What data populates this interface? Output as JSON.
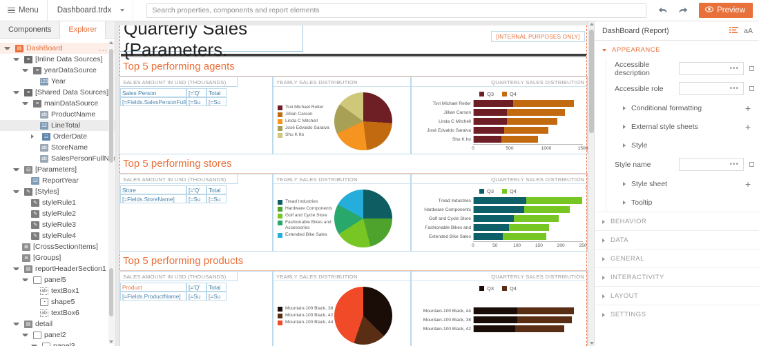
{
  "topbar": {
    "menu_label": "Menu",
    "file_name": "Dashboard.trdx",
    "search_placeholder": "Search properties, components and report elements",
    "search_value": "",
    "undo_icon": "undo-arrow-icon",
    "redo_icon": "redo-arrow-icon",
    "preview_label": "Preview",
    "preview_icon": "eye-icon",
    "accent_color": "#e8703a"
  },
  "left_panel": {
    "tabs": [
      {
        "label": "Components",
        "active": false
      },
      {
        "label": "Explorer",
        "active": true
      }
    ],
    "tree": [
      {
        "label": "DashBoard",
        "indent": 0,
        "arrow": "down",
        "icon": "report-icon",
        "icon_class": "ico-report",
        "glyph": "▤",
        "state": "root",
        "menu": "..."
      },
      {
        "label": "[Inline Data Sources]",
        "indent": 1,
        "arrow": "down",
        "icon": "data-sources-icon",
        "icon_class": "ico-ds",
        "glyph": "≡",
        "state": ""
      },
      {
        "label": "yearDataSource",
        "indent": 2,
        "arrow": "down",
        "icon": "data-source-icon",
        "icon_class": "ico-ds2",
        "glyph": "≡",
        "state": ""
      },
      {
        "label": "Year",
        "indent": 3,
        "arrow": "blank",
        "icon": "field-icon",
        "icon_class": "ico-num",
        "glyph": "123",
        "state": ""
      },
      {
        "label": "[Shared Data Sources]",
        "indent": 1,
        "arrow": "down",
        "icon": "data-sources-icon",
        "icon_class": "ico-ds",
        "glyph": "≡",
        "state": ""
      },
      {
        "label": "mainDataSource",
        "indent": 2,
        "arrow": "down",
        "icon": "data-source-icon",
        "icon_class": "ico-ds2",
        "glyph": "≡",
        "state": ""
      },
      {
        "label": "ProductName",
        "indent": 3,
        "arrow": "blank",
        "icon": "text-field-icon",
        "icon_class": "ico-field",
        "glyph": "ab",
        "state": ""
      },
      {
        "label": "LineTotal",
        "indent": 3,
        "arrow": "blank",
        "icon": "number-field-icon",
        "icon_class": "ico-num",
        "glyph": "12",
        "state": "sel"
      },
      {
        "label": "OrderDate",
        "indent": 3,
        "arrow": "right",
        "icon": "date-field-icon",
        "icon_class": "ico-date",
        "glyph": "☷",
        "state": ""
      },
      {
        "label": "StoreName",
        "indent": 3,
        "arrow": "blank",
        "icon": "text-field-icon",
        "icon_class": "ico-field",
        "glyph": "ab",
        "state": ""
      },
      {
        "label": "SalesPersonFullName",
        "indent": 3,
        "arrow": "blank",
        "icon": "text-field-icon",
        "icon_class": "ico-field",
        "glyph": "ab",
        "state": ""
      },
      {
        "label": "[Parameters]",
        "indent": 1,
        "arrow": "down",
        "icon": "parameters-icon",
        "icon_class": "ico-param",
        "glyph": "⊟",
        "state": ""
      },
      {
        "label": "ReportYear",
        "indent": 2,
        "arrow": "blank",
        "icon": "parameter-icon",
        "icon_class": "ico-num",
        "glyph": "12",
        "state": ""
      },
      {
        "label": "[Styles]",
        "indent": 1,
        "arrow": "down",
        "icon": "styles-icon",
        "icon_class": "ico-style",
        "glyph": "✎",
        "state": ""
      },
      {
        "label": "styleRule1",
        "indent": 2,
        "arrow": "blank",
        "icon": "style-rule-icon",
        "icon_class": "ico-style",
        "glyph": "✎",
        "state": ""
      },
      {
        "label": "styleRule2",
        "indent": 2,
        "arrow": "blank",
        "icon": "style-rule-icon",
        "icon_class": "ico-style",
        "glyph": "✎",
        "state": ""
      },
      {
        "label": "styleRule3",
        "indent": 2,
        "arrow": "blank",
        "icon": "style-rule-icon",
        "icon_class": "ico-style",
        "glyph": "✎",
        "state": ""
      },
      {
        "label": "styleRule4",
        "indent": 2,
        "arrow": "blank",
        "icon": "style-rule-icon",
        "icon_class": "ico-style",
        "glyph": "✎",
        "state": ""
      },
      {
        "label": "[CrossSectionItems]",
        "indent": 1,
        "arrow": "blank",
        "icon": "grid-icon",
        "icon_class": "ico-grid",
        "glyph": "⊞",
        "state": ""
      },
      {
        "label": "[Groups]",
        "indent": 1,
        "arrow": "blank",
        "icon": "groups-icon",
        "icon_class": "ico-group",
        "glyph": "≣",
        "state": ""
      },
      {
        "label": "reportHeaderSection1",
        "indent": 1,
        "arrow": "down",
        "icon": "section-icon",
        "icon_class": "ico-section",
        "glyph": "▤",
        "state": ""
      },
      {
        "label": "panel5",
        "indent": 2,
        "arrow": "down",
        "icon": "panel-icon",
        "icon_class": "ico-panel",
        "glyph": "",
        "state": ""
      },
      {
        "label": "textBox1",
        "indent": 3,
        "arrow": "blank",
        "icon": "textbox-icon",
        "icon_class": "ico-textbox",
        "glyph": "ab",
        "state": ""
      },
      {
        "label": "shape5",
        "indent": 3,
        "arrow": "blank",
        "icon": "shape-icon",
        "icon_class": "ico-shape",
        "glyph": "◔",
        "state": ""
      },
      {
        "label": "textBox6",
        "indent": 3,
        "arrow": "blank",
        "icon": "textbox-icon",
        "icon_class": "ico-textbox",
        "glyph": "ab",
        "state": ""
      },
      {
        "label": "detail",
        "indent": 1,
        "arrow": "down",
        "icon": "section-icon",
        "icon_class": "ico-section",
        "glyph": "▤",
        "state": ""
      },
      {
        "label": "panel2",
        "indent": 2,
        "arrow": "down",
        "icon": "panel-icon",
        "icon_class": "ico-panel",
        "glyph": "",
        "state": ""
      },
      {
        "label": "panel3",
        "indent": 3,
        "arrow": "down",
        "icon": "panel-icon",
        "icon_class": "ico-panel",
        "glyph": "",
        "state": ""
      }
    ]
  },
  "canvas": {
    "report_title": "Quarterly Sales {Parameters.",
    "internal_badge": "[INTERNAL PURPOSES ONLY]",
    "sections": [
      {
        "title": "Top 5 performing agents",
        "panel_a_header": "SALES AMOUNT IN USD (THOUSANDS)",
        "panel_b_header": "YEARLY SALES DISTRIBUTION",
        "panel_c_header": "QUARTERLY SALES DISTRIBUTION",
        "table": {
          "header": [
            "Sales Person",
            "[='Q'",
            "Total"
          ],
          "row": [
            "[=Fields.SalesPersonFull",
            "[=Su",
            "[=Su"
          ],
          "header_color": "#3b7fa8"
        }
      },
      {
        "title": "Top 5 performing stores",
        "panel_a_header": "SALES AMOUNT IN USD (THOUSANDS)",
        "panel_b_header": "YEARLY SALES DISTRIBUTION",
        "panel_c_header": "QUARTERLY SALES DISTRIBUTION",
        "table": {
          "header": [
            "Store",
            "[='Q'",
            "Total"
          ],
          "row": [
            "[=Fields.StoreName]",
            "[=Su",
            "[=Su"
          ],
          "header_color": "#3b7fa8"
        }
      },
      {
        "title": "Top 5 performing products",
        "panel_a_header": "SALES AMOUNT IN USD (THOUSANDS)",
        "panel_b_header": "YEARLY SALES DISTRIBUTION",
        "panel_c_header": "QUARTERLY SALES DISTRIBUTION",
        "table": {
          "header": [
            "Product",
            "[='Q'",
            "Total"
          ],
          "row": [
            "[=Fields.ProductName]",
            "[=Su",
            "[=Su"
          ],
          "header_color": "#e8703a"
        }
      }
    ]
  },
  "right_panel": {
    "title": "DashBoard (Report)",
    "sort_icon": "sort-list-icon",
    "alpha_icon": "alphabetical-sort-icon",
    "alpha_label": "aA",
    "groups": [
      {
        "label": "APPEARANCE",
        "open": true
      },
      {
        "label": "BEHAVIOR",
        "open": false
      },
      {
        "label": "DATA",
        "open": false
      },
      {
        "label": "GENERAL",
        "open": false
      },
      {
        "label": "INTERACTIVITY",
        "open": false
      },
      {
        "label": "LAYOUT",
        "open": false
      },
      {
        "label": "SETTINGS",
        "open": false
      }
    ],
    "appearance_rows": [
      {
        "kind": "field",
        "label": "Accessible description",
        "value": "",
        "ellipsis": "•••"
      },
      {
        "kind": "field",
        "label": "Accessible role",
        "value": "",
        "ellipsis": "•••"
      },
      {
        "kind": "sub",
        "label": "Conditional formatting",
        "plus": "+"
      },
      {
        "kind": "sub",
        "label": "External style sheets",
        "plus": "+"
      },
      {
        "kind": "sub",
        "label": "Style",
        "plus": ""
      },
      {
        "kind": "field",
        "label": "Style name",
        "value": "",
        "ellipsis": "•••"
      },
      {
        "kind": "sub",
        "label": "Style sheet",
        "plus": "+"
      },
      {
        "kind": "sub",
        "label": "Tooltip",
        "plus": ""
      }
    ]
  },
  "chart_data": [
    {
      "type": "pie",
      "id": "agents-yearly-pie",
      "title": "YEARLY SALES DISTRIBUTION",
      "labels": [
        "Tsvi Michael Reiter",
        "Jillian  Carson",
        "Linda C Mitchell",
        "José Edvaldo Saraiva",
        "Shu K Ito"
      ],
      "values": [
        26,
        22,
        20,
        17,
        15
      ],
      "colors": [
        "#6e1f26",
        "#c26a10",
        "#f5941f",
        "#a8a055",
        "#cfc87a"
      ],
      "legend": "left"
    },
    {
      "type": "bar",
      "id": "agents-quarterly-bars",
      "title": "QUARTERLY SALES DISTRIBUTION",
      "orientation": "horizontal",
      "stacked": true,
      "categories": [
        "Tsvi Michael Reiter",
        "Jillian  Carson",
        "Linda C Mitchell",
        "José Edvaldo Saraiva",
        "Shu K Ito"
      ],
      "series": [
        {
          "name": "Q3",
          "values": [
            540,
            460,
            455,
            420,
            375
          ],
          "color": "#6e1f26"
        },
        {
          "name": "Q4",
          "values": [
            840,
            790,
            690,
            610,
            505
          ],
          "color": "#c26a10"
        }
      ],
      "xlim": [
        0,
        1500
      ],
      "xticks": [
        0,
        500,
        1000,
        1500
      ],
      "legend": "top"
    },
    {
      "type": "pie",
      "id": "stores-yearly-pie",
      "title": "YEARLY SALES DISTRIBUTION",
      "labels": [
        "Tread Industries",
        "Hardware Components",
        "Golf and Cycle Store",
        "Fashionable Bikes and Accessories",
        "Extended Bike Sales"
      ],
      "values": [
        25,
        21,
        20,
        17,
        17
      ],
      "colors": [
        "#0d5d63",
        "#4da32c",
        "#77c623",
        "#28a86a",
        "#25addb"
      ],
      "legend": "left"
    },
    {
      "type": "bar",
      "id": "stores-quarterly-bars",
      "title": "QUARTERLY SALES DISTRIBUTION",
      "orientation": "horizontal",
      "stacked": true,
      "categories": [
        "Tread Industries",
        "Hardware Components",
        "Golf and Cycle Store",
        "Fashionable Bikes and",
        "Extended Bike Sales"
      ],
      "series": [
        {
          "name": "Q3",
          "values": [
            120,
            115,
            92,
            80,
            66
          ],
          "color": "#0d6068"
        },
        {
          "name": "Q4",
          "values": [
            128,
            105,
            102,
            93,
            100
          ],
          "color": "#77c623"
        }
      ],
      "xlim": [
        0,
        250
      ],
      "xticks": [
        0,
        50,
        100,
        150,
        200,
        250
      ],
      "legend": "top"
    },
    {
      "type": "pie",
      "id": "products-yearly-pie",
      "title": "YEARLY SALES DISTRIBUTION",
      "labels": [
        "Mountain-100 Black, 38",
        "Mountain-100 Black, 42",
        "Mountain-100 Black, 44"
      ],
      "values": [
        25,
        12,
        30
      ],
      "colors": [
        "#1a0d08",
        "#5a2d15",
        "#f04a28"
      ],
      "legend": "left"
    },
    {
      "type": "bar",
      "id": "products-quarterly-bars",
      "title": "QUARTERLY SALES DISTRIBUTION",
      "orientation": "horizontal",
      "stacked": true,
      "categories": [
        "Mountain-100 Black, 44",
        "Mountain-100 Black, 38",
        "Mountain-100 Black, 42"
      ],
      "series": [
        {
          "name": "Q3",
          "values": [
            40,
            40,
            38
          ],
          "color": "#1a0d08"
        },
        {
          "name": "Q4",
          "values": [
            52,
            50,
            45
          ],
          "color": "#5a2d15"
        }
      ],
      "xlim": [
        0,
        100
      ],
      "legend": "top"
    }
  ]
}
